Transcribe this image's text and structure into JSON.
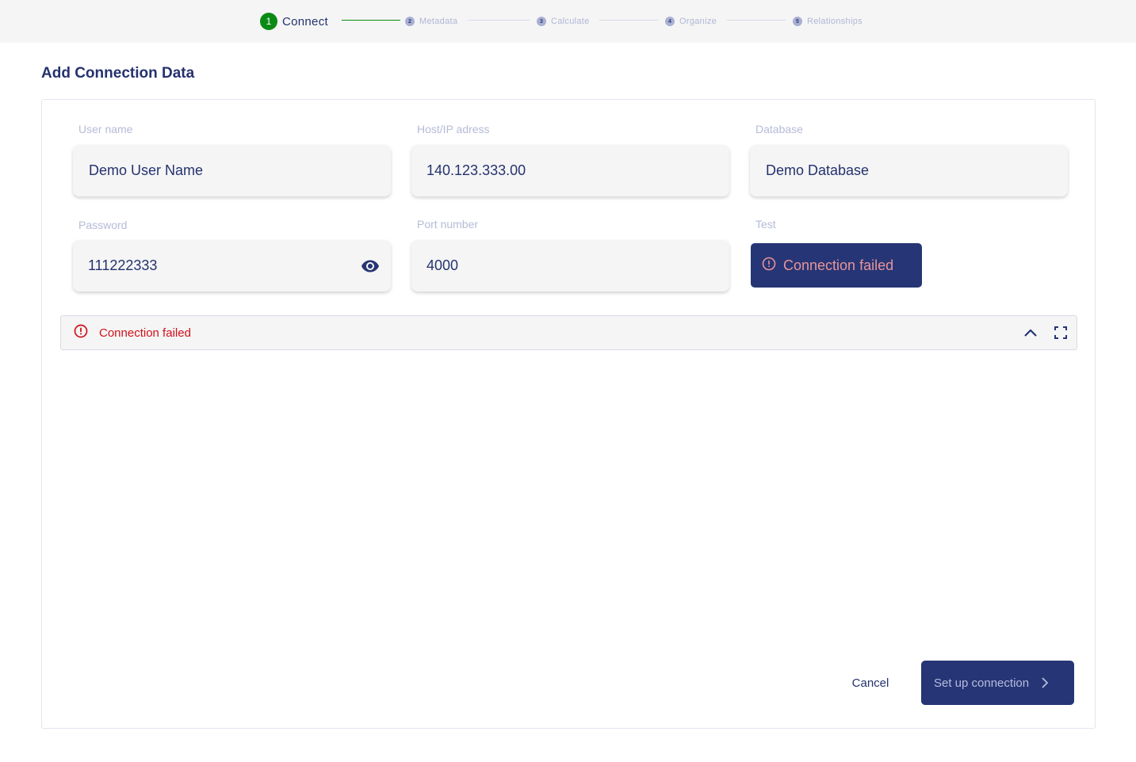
{
  "stepper": {
    "steps": [
      {
        "number": "1",
        "label": "Connect",
        "state": "active"
      },
      {
        "number": "2",
        "label": "Metadata",
        "state": "pending"
      },
      {
        "number": "3",
        "label": "Calculate",
        "state": "pending"
      },
      {
        "number": "4",
        "label": "Organize",
        "state": "pending"
      },
      {
        "number": "5",
        "label": "Relationships",
        "state": "pending"
      }
    ]
  },
  "page": {
    "title": "Add Connection Data"
  },
  "form": {
    "user_name": {
      "label": "User name",
      "value": "Demo User Name"
    },
    "host": {
      "label": "Host/IP adress",
      "value": "140.123.333.00"
    },
    "database": {
      "label": "Database",
      "value": "Demo Database"
    },
    "password": {
      "label": "Password",
      "value": "111222333",
      "icon": "eye-icon"
    },
    "port": {
      "label": "Port number",
      "value": "4000"
    },
    "test": {
      "label": "Test",
      "button_label": "Connection failed",
      "icon": "alert-circle-icon"
    }
  },
  "alert": {
    "message": "Connection failed",
    "icon": "alert-circle-icon",
    "actions": [
      "chevron-up-icon",
      "fullscreen-icon"
    ]
  },
  "footer": {
    "cancel_label": "Cancel",
    "submit_label": "Set up connection",
    "submit_icon": "chevron-right-icon"
  },
  "colors": {
    "primary": "#263575",
    "success": "#0b8a15",
    "error": "#d0101a",
    "error_soft": "#e8949a"
  }
}
